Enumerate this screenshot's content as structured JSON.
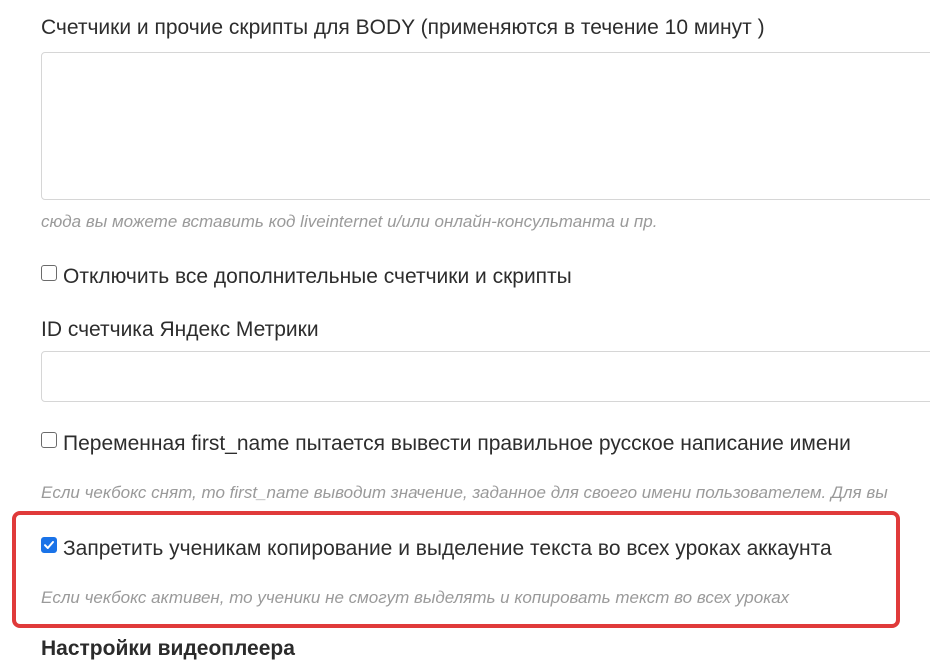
{
  "body_scripts": {
    "label": "Счетчики и прочие скрипты для BODY (применяются в течение 10 минут )",
    "value": "",
    "hint": "сюда вы можете вставить код liveinternet и/или онлайн-консультанта и пр."
  },
  "disable_scripts": {
    "label": "Отключить все дополнительные счетчики и скрипты",
    "checked": false
  },
  "yandex_metrika": {
    "label": "ID счетчика Яндекс Метрики",
    "value": ""
  },
  "first_name_option": {
    "label": "Переменная first_name пытается вывести правильное русское написание имени",
    "checked": false,
    "hint": "Если чекбокс снят, то first_name выводит значение, заданное для своего имени пользователем. Для вы"
  },
  "copy_protection": {
    "label": "Запретить ученикам копирование и выделение текста во всех уроках аккаунта",
    "checked": true,
    "hint": "Если чекбокс активен, то ученики не смогут выделять и копировать текст во всех уроках"
  },
  "video_settings": {
    "title": "Настройки видеоплеера"
  },
  "colors": {
    "highlight": "#e03a3a",
    "checkbox_accent": "#1a73e8",
    "hint_text": "#9a9a9a"
  }
}
